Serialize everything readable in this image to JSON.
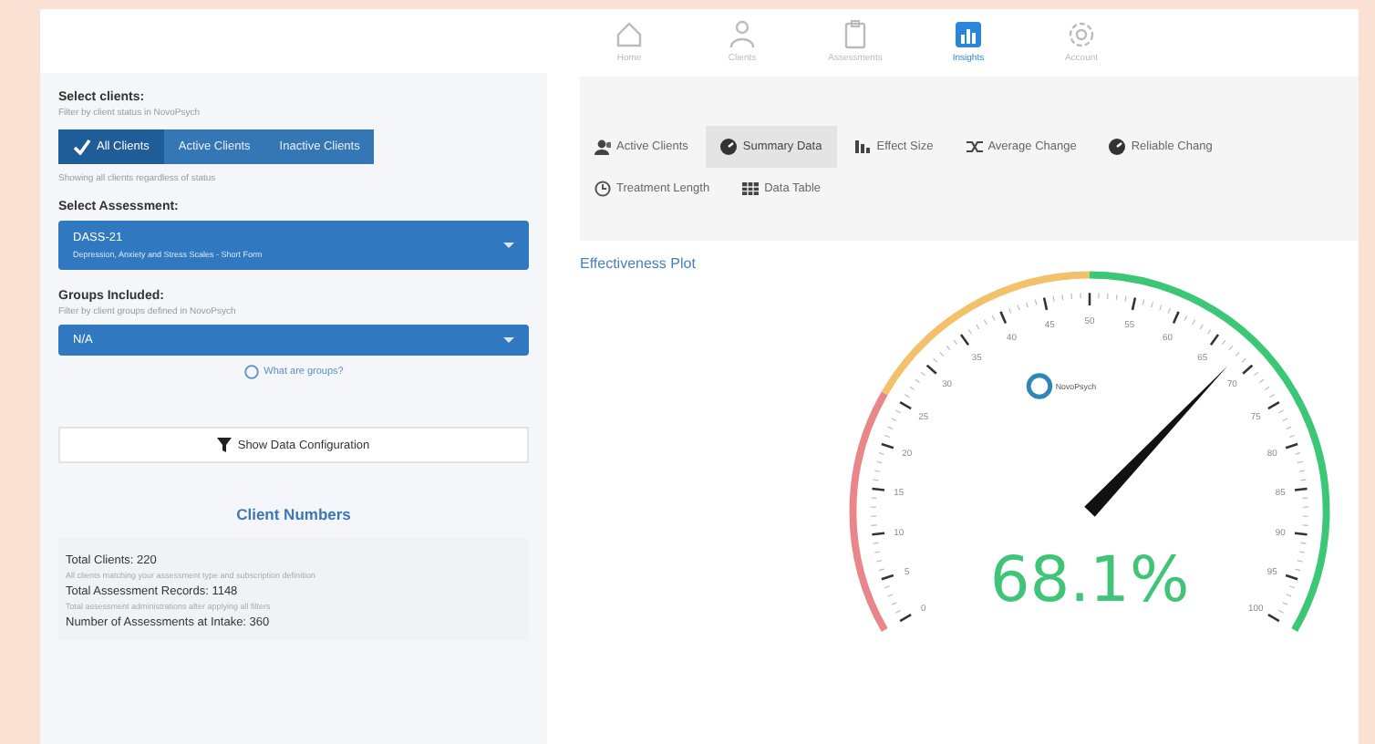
{
  "nav": [
    {
      "label": "Home",
      "kind": "home",
      "selected": false
    },
    {
      "label": "Clients",
      "kind": "clients",
      "selected": false
    },
    {
      "label": "Assessments",
      "kind": "assessments",
      "selected": false
    },
    {
      "label": "Insights",
      "kind": "insights",
      "selected": true
    },
    {
      "label": "Account",
      "kind": "account",
      "selected": false
    }
  ],
  "sidebar": {
    "client_filter": {
      "label": "Select clients:",
      "hint": "Filter by client status in NovoPsych",
      "options": [
        {
          "label": "All Clients",
          "selected": true
        },
        {
          "label": "Active Clients",
          "selected": false
        },
        {
          "label": "Inactive Clients",
          "selected": false
        }
      ],
      "status": "Showing all clients regardless of status"
    },
    "assessment": {
      "label": "Select Assessment:",
      "value": "DASS-21",
      "subtitle": "Depression, Anxiety and Stress Scales - Short Form"
    },
    "groups": {
      "label": "Groups Included:",
      "hint": "Filter by client groups defined in NovoPsych",
      "value": "N/A",
      "help_link": "What are groups?"
    },
    "config_button": "Show Data Configuration",
    "client_numbers": {
      "title": "Client Numbers",
      "stats": [
        {
          "label": "Total Clients: 220",
          "description": "All clients matching your assessment type and subscription definition"
        },
        {
          "label": "Total Assessment Records: 1148",
          "description": "Total assessment administrations after applying all filters"
        },
        {
          "label": "Number of Assessments at Intake: 360"
        }
      ]
    }
  },
  "tabs": [
    {
      "label": "Active Clients",
      "kind": "users",
      "selected": false
    },
    {
      "label": "Summary Data",
      "kind": "gauge",
      "selected": true
    },
    {
      "label": "Effect Size",
      "kind": "bars",
      "selected": false
    },
    {
      "label": "Average Change",
      "kind": "shuffle",
      "selected": false
    },
    {
      "label": "Reliable Chang",
      "kind": "gauge",
      "selected": false
    },
    {
      "label": "Treatment Length",
      "kind": "clock",
      "selected": false
    },
    {
      "label": "Data Table",
      "kind": "table",
      "selected": false
    }
  ],
  "plot": {
    "title": "Effectiveness Plot",
    "gauge": {
      "reading": "68.1%",
      "logo_text": "NovoPsych",
      "tick_labels": [
        "0",
        "5",
        "10",
        "15",
        "20",
        "25",
        "30",
        "35",
        "40",
        "45",
        "50",
        "55",
        "60",
        "65",
        "70",
        "75",
        "80",
        "85",
        "90",
        "95",
        "100"
      ]
    }
  }
}
